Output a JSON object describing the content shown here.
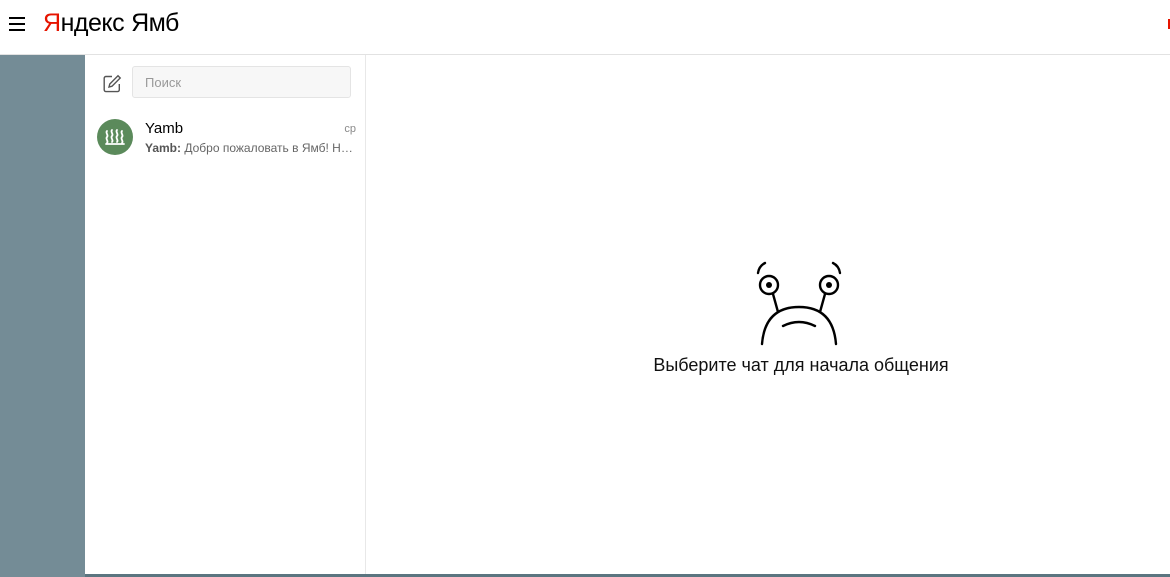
{
  "header": {
    "menu_icon": "hamburger-icon",
    "logo_first_letter": "Я",
    "logo_rest": "ндекс",
    "service_name": "Ямб",
    "logo_colors": {
      "first_letter": "#e61400",
      "text": "#000000"
    }
  },
  "sidebar": {
    "compose_icon": "compose-icon",
    "search": {
      "placeholder": "Поиск",
      "value": ""
    },
    "chats": [
      {
        "name": "Yamb",
        "time": "ср",
        "sender": "Yamb:",
        "preview": " Добро пожаловать в Ямб! Н…",
        "avatar_color": "#5b8a5b",
        "avatar_icon": "yamb-logo-icon"
      }
    ]
  },
  "main": {
    "empty_icon": "sad-bug-icon",
    "empty_message": "Выберите чат для начала общения"
  },
  "colors": {
    "background": "#748c96",
    "panel": "#ffffff",
    "accent": "#e61400"
  }
}
